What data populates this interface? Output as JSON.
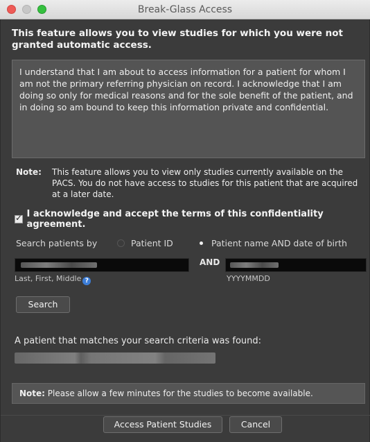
{
  "window": {
    "title": "Break-Glass Access"
  },
  "header": {
    "text": "This feature allows you to view studies for which you were not granted automatic access."
  },
  "agreement": {
    "text": "I understand that I am about to access information for a patient for whom I am not the primary referring physician on record. I acknowledge that I am doing so only for medical reasons and for the sole benefit of the patient, and in doing so am bound to keep this information private and confidential."
  },
  "note": {
    "label": "Note:",
    "text": "This feature allows you to view only studies currently available on the PACS. You do not have access to studies for this patient that are acquired at a later date."
  },
  "acknowledge": {
    "checked": true,
    "label": "I acknowledge and accept the terms of this confidentiality agreement."
  },
  "search_by": {
    "label": "Search patients by",
    "options": [
      "Patient ID",
      "Patient name AND date of birth"
    ],
    "selected": "Patient name AND date of birth"
  },
  "name_field": {
    "hint": "Last, First, Middle"
  },
  "and_label": "AND",
  "dob_field": {
    "hint": "YYYYMMDD"
  },
  "buttons": {
    "search": "Search",
    "access": "Access Patient Studies",
    "cancel": "Cancel"
  },
  "result": {
    "found_text": "A patient that matches your search criteria was found:"
  },
  "bottom_note": {
    "label": "Note:",
    "text": "Please allow a few minutes for the studies to become available."
  },
  "colors": {
    "window_bg": "#3b3b3b",
    "panel_bg": "#545454",
    "input_bg": "#0a0a0a",
    "help_icon": "#3d7ed8"
  },
  "icons": {
    "help": "help-question-icon",
    "checkbox": "check-icon"
  }
}
